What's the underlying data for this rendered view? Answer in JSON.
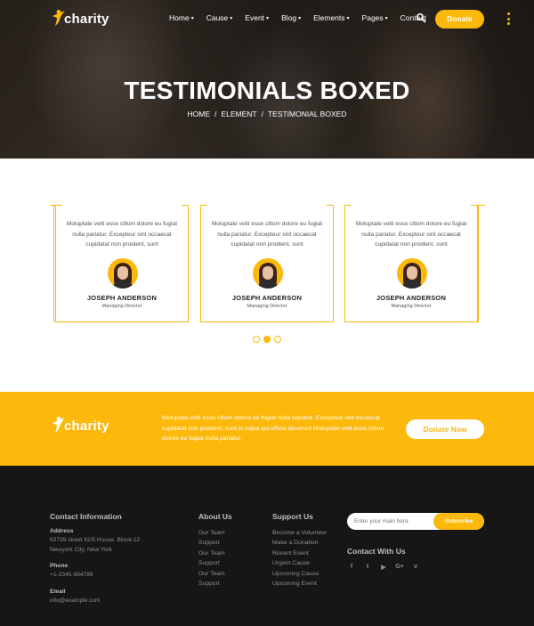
{
  "header": {
    "logo_text": "charity",
    "nav": [
      {
        "label": "Home",
        "dropdown": true
      },
      {
        "label": "Cause",
        "dropdown": true
      },
      {
        "label": "Event",
        "dropdown": true
      },
      {
        "label": "Blog",
        "dropdown": true
      },
      {
        "label": "Elements",
        "dropdown": true
      },
      {
        "label": "Pages",
        "dropdown": true
      },
      {
        "label": "Contact",
        "dropdown": false
      }
    ],
    "donate_label": "Donate"
  },
  "hero": {
    "title": "TESTIMONIALS BOXED",
    "breadcrumb": [
      "HOME",
      "ELEMENT",
      "TESTIMONIAL BOXED"
    ]
  },
  "testimonials": [
    {
      "text": "Moluptate velit esse cillum dolore eu fugiat nulla pariatur. Excepteur sint occaecat cupidatat non proident, sunt",
      "name": "JOSEPH ANDERSON",
      "role": "Managing Director"
    },
    {
      "text": "Moluptate velit esse cillum dolore eu fugiat nulla pariatur. Excepteur sint occaecat cupidatat non proident, sunt",
      "name": "JOSEPH ANDERSON",
      "role": "Managing Director"
    },
    {
      "text": "Moluptate velit esse cillum dolore eu fugiat nulla pariatur. Excepteur sint occaecat cupidatat non proident, sunt",
      "name": "JOSEPH ANDERSON",
      "role": "Managing Director"
    }
  ],
  "carousel": {
    "pages": 3,
    "active_index": 1
  },
  "cta": {
    "logo_text": "charity",
    "text": "Moluptate velit esse cillum dolore eu fugiat nulla pariatur. Excepteur sint occaecat cupidatat non proident, sunt in culpa qui officia deserunt Moluptate velit esse cillum dolore eu fugiat nulla pariatur.",
    "button_label": "Donate Now"
  },
  "footer": {
    "contact": {
      "heading": "Contact Information",
      "address_label": "Address",
      "address_line1": "63739 street lt2/5 House, Block-12",
      "address_line2": "Newyork City, New York",
      "phone_label": "Phone",
      "phone": "+1-2345-564789",
      "email_label": "Email",
      "email": "info@example.com"
    },
    "about": {
      "heading": "About Us",
      "links": [
        "Our Team",
        "Support",
        "Our Team",
        "Support",
        "Our Team",
        "Support"
      ]
    },
    "support": {
      "heading": "Support Us",
      "links": [
        "Become a Volunteer",
        "Make a Donation",
        "Recent Event",
        "Urgent Cause",
        "Upcoming Cause",
        "Upcoming Event"
      ]
    },
    "newsletter": {
      "placeholder": "Enter your main here",
      "button_label": "Subscribe"
    },
    "social": {
      "heading": "Contact With Us",
      "icons": [
        "f",
        "t",
        "▶",
        "G+",
        "v"
      ]
    }
  },
  "colors": {
    "accent": "#fcb80b",
    "footer_bg": "#161616"
  }
}
